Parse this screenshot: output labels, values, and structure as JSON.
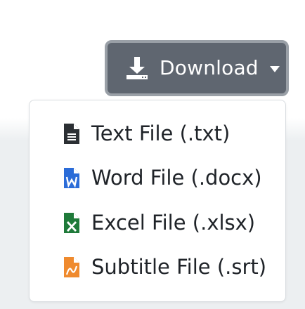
{
  "download_button": {
    "label": "Download",
    "icon": "download-icon",
    "color": "#5f6670"
  },
  "dropdown": {
    "items": [
      {
        "label": "Text File (.txt)",
        "icon": "file-text-icon",
        "color": "#2b2f33"
      },
      {
        "label": "Word File (.docx)",
        "icon": "file-word-icon",
        "color": "#2b6cd8"
      },
      {
        "label": "Excel File (.xlsx)",
        "icon": "file-excel-icon",
        "color": "#1f7a3a"
      },
      {
        "label": "Subtitle File (.srt)",
        "icon": "file-subtitle-icon",
        "color": "#ef8a2e"
      }
    ]
  }
}
